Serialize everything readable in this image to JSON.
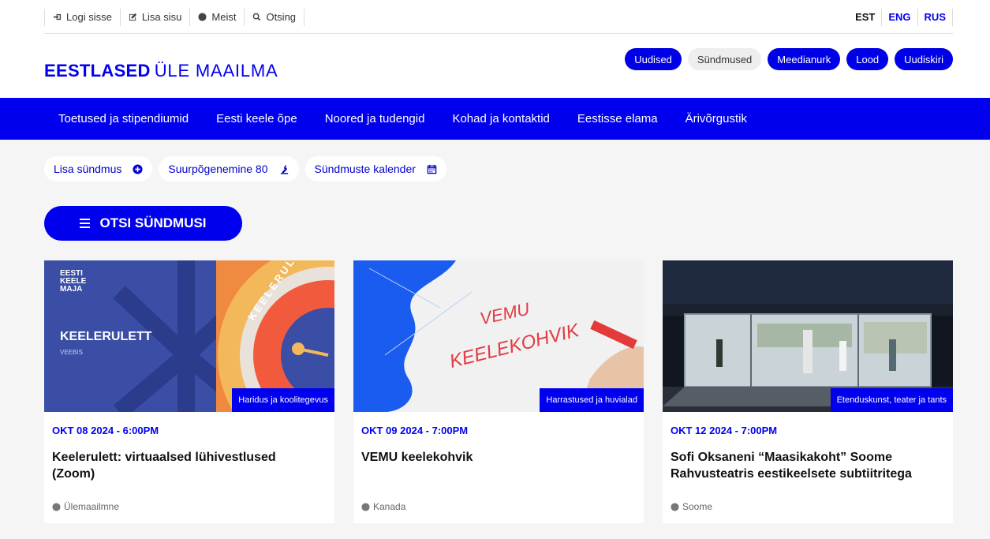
{
  "utility": {
    "login": "Logi sisse",
    "add_content": "Lisa sisu",
    "about": "Meist",
    "search": "Otsing"
  },
  "languages": [
    "EST",
    "ENG",
    "RUS"
  ],
  "logo": {
    "bold": "EESTLASED",
    "light": "ÜLE MAAILMA"
  },
  "sections": [
    "Uudised",
    "Sündmused",
    "Meedianurk",
    "Lood",
    "Uudiskiri"
  ],
  "nav": [
    "Toetused ja stipendiumid",
    "Eesti keele õpe",
    "Noored ja tudengid",
    "Kohad ja kontaktid",
    "Eestisse elama",
    "Ärivõrgustik"
  ],
  "chips": {
    "add_event": "Lisa sündmus",
    "song_festival": "Suurpõgenemine 80",
    "calendar": "Sündmuste kalender"
  },
  "search_button": "OTSI SÜNDMUSI",
  "cards": [
    {
      "category": "Haridus ja koolitegevus",
      "date": "OKT 08 2024 - 6:00PM",
      "title": "Keelerulett: virtuaalsed lühivestlused (Zoom)",
      "location": "Ülemaailmne",
      "image_text": {
        "brand": "EESTI KEELE MAJA",
        "heading": "KEELERULETT",
        "sub": "VEEBIS",
        "wheel": "KEELERULETT"
      }
    },
    {
      "category": "Harrastused ja huvialad",
      "date": "OKT 09 2024 - 7:00PM",
      "title": "VEMU keelekohvik",
      "location": "Kanada",
      "image_text": {
        "line1": "VEMU",
        "line2": "KEELEKOHVIK"
      }
    },
    {
      "category": "Etenduskunst, teater ja tants",
      "date": "OKT 12 2024 - 7:00PM",
      "title": "Sofi Oksaneni “Maasikakoht” Soome Rahvusteatris eestikeelsete subtiitritega",
      "location": "Soome"
    }
  ],
  "colors": {
    "brand_blue": "#0000ee",
    "background": "#f5f5f5"
  }
}
